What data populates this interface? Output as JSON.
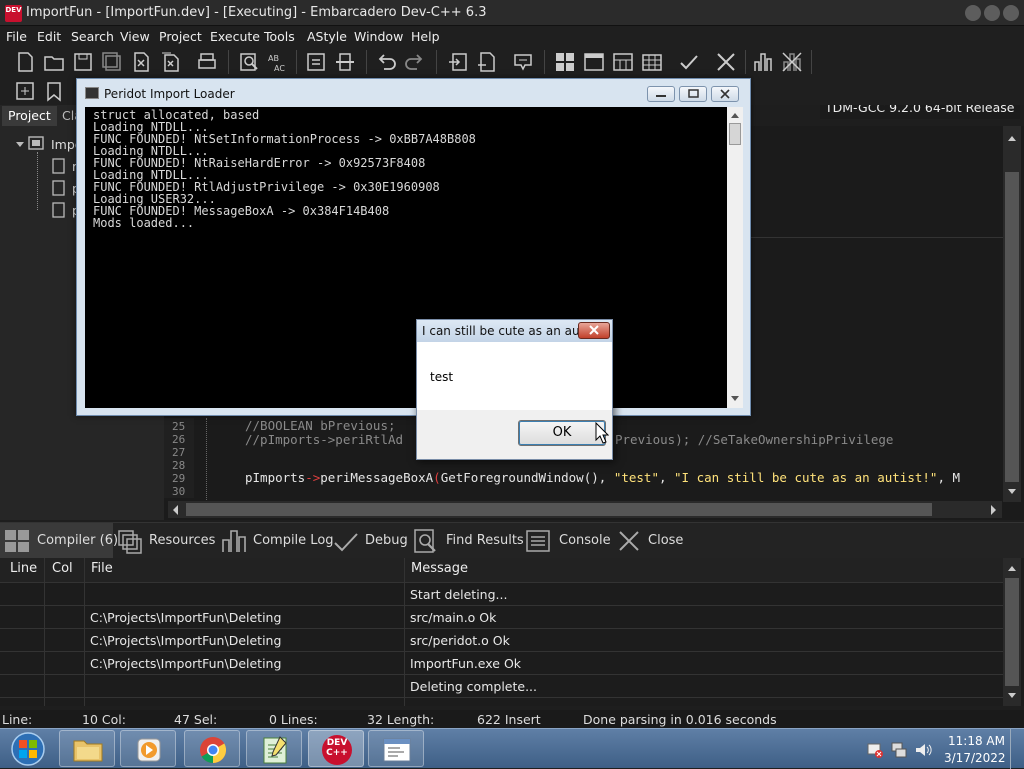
{
  "window": {
    "title": "ImportFun - [ImportFun.dev] - [Executing] - Embarcadero Dev-C++ 6.3",
    "logo_text": "DEV"
  },
  "menu": [
    "File",
    "Edit",
    "Search",
    "View",
    "Project",
    "Execute",
    "Tools",
    "AStyle",
    "Window",
    "Help"
  ],
  "toolbar": {
    "compiler": "TDM-GCC 9.2.0 64-bit Release"
  },
  "left_panel": {
    "tabs": [
      "Project",
      "Cla"
    ],
    "tree_root": "Impo",
    "tree_children": [
      "m",
      "p",
      "p"
    ]
  },
  "editor": {
    "lines": [
      {
        "num": "25",
        "text": "//BOOLEAN bPrevious;"
      },
      {
        "num": "26",
        "text": "//pImports->periRtlAd"
      },
      {
        "num": "27",
        "text": ""
      },
      {
        "num": "28",
        "text": ""
      },
      {
        "num": "29",
        "text": ""
      },
      {
        "num": "30",
        "text": ""
      }
    ],
    "line26_tail": "Previous); //SeTakeOwnershipPrivilege",
    "line29": {
      "obj": "pImports",
      "arrow": "->",
      "fn": "periMessageBoxA",
      "open": "(",
      "arg1": "GetForegroundWindow",
      "parens": "(), ",
      "arg2": "\"test\"",
      "comma": ", ",
      "arg3": "\"I can still be cute as an autist!\"",
      "tail": ", M"
    }
  },
  "bottom_tabs": [
    {
      "label": "Compiler (6)",
      "icon": "grid-icon"
    },
    {
      "label": "Resources",
      "icon": "resources-icon"
    },
    {
      "label": "Compile Log",
      "icon": "chart-icon"
    },
    {
      "label": "Debug",
      "icon": "check-icon"
    },
    {
      "label": "Find Results",
      "icon": "find-icon"
    },
    {
      "label": "Console",
      "icon": "console-icon"
    },
    {
      "label": "Close",
      "icon": "close-icon"
    }
  ],
  "messages": {
    "columns": [
      "Line",
      "Col",
      "File",
      "Message"
    ],
    "rows": [
      {
        "file": "",
        "message": "Start deleting..."
      },
      {
        "file": "C:\\Projects\\ImportFun\\Deleting",
        "message": "src/main.o Ok"
      },
      {
        "file": "C:\\Projects\\ImportFun\\Deleting",
        "message": "src/peridot.o Ok"
      },
      {
        "file": "C:\\Projects\\ImportFun\\Deleting",
        "message": "ImportFun.exe Ok"
      },
      {
        "file": "",
        "message": "Deleting complete..."
      }
    ]
  },
  "status": {
    "line": "Line:",
    "col": "10 Col:",
    "sel": "47 Sel:",
    "lines": "0 Lines:",
    "length": "32 Length:",
    "insert": "622 Insert",
    "parse": "Done parsing in 0.016 seconds"
  },
  "loader": {
    "title": "Peridot Import Loader",
    "console": [
      "struct allocated, based",
      "Loading NTDLL...",
      "FUNC FOUNDED! NtSetInformationProcess -> 0xBB7A48B808",
      "Loading NTDLL...",
      "FUNC FOUNDED! NtRaiseHardError -> 0x92573F8408",
      "Loading NTDLL...",
      "FUNC FOUNDED! RtlAdjustPrivilege -> 0x30E1960908",
      "Loading USER32...",
      "FUNC FOUNDED! MessageBoxA -> 0x384F14B408",
      "Mods loaded..."
    ]
  },
  "msgbox": {
    "title": "I can still be cute as an autist!",
    "text": "test",
    "ok": "OK"
  },
  "taskbar": {
    "time": "11:18 AM",
    "date": "3/17/2022",
    "devcpp_label": "DEV C++"
  },
  "colors": {
    "comment": "#8a8a8a",
    "string": "#ffe27a",
    "ident": "#e6e6e6",
    "func": "#e6e6e6",
    "operator": "#e04040",
    "accent": "#c8102e"
  }
}
